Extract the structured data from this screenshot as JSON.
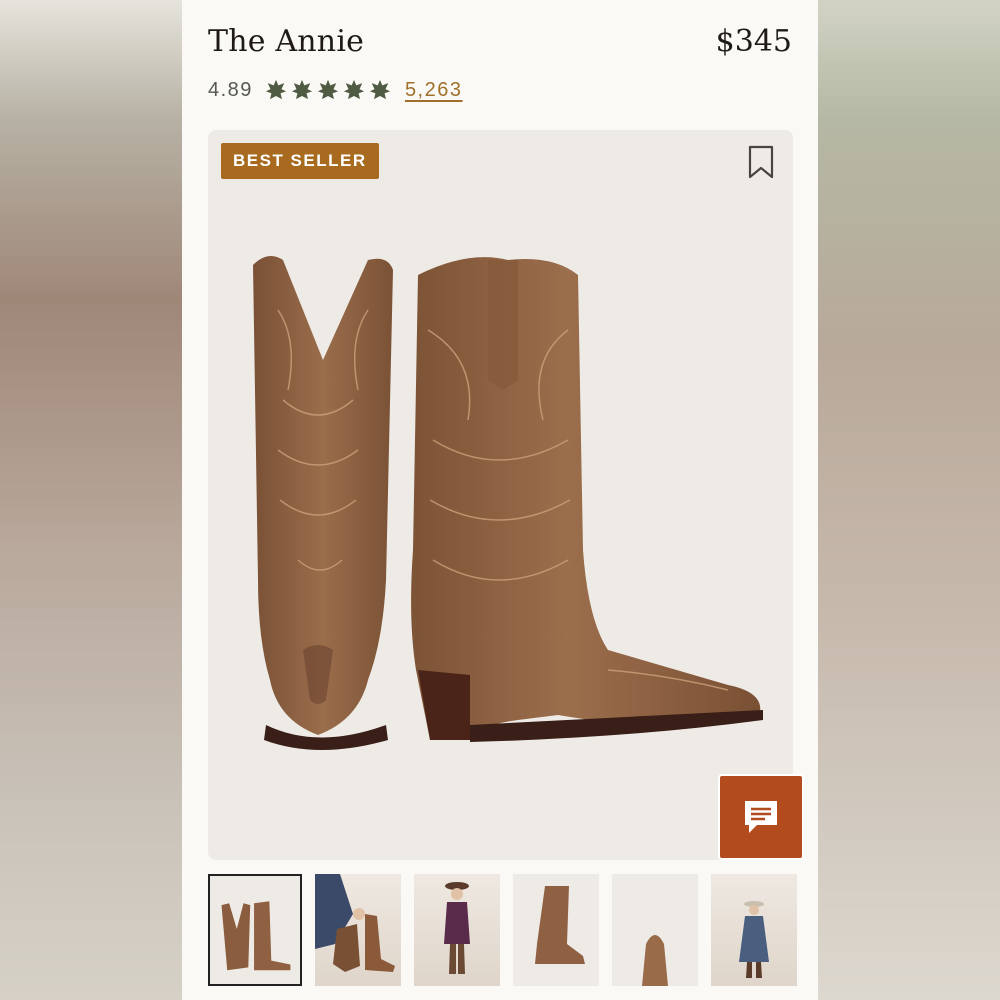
{
  "product": {
    "name": "The Annie",
    "price": "$345",
    "rating": "4.89",
    "review_count": "5,263",
    "stars": 5
  },
  "hero": {
    "badge": "BEST SELLER",
    "bookmark_icon": "bookmark-icon"
  },
  "chat": {
    "icon": "chat-icon",
    "color": "#b24b1e"
  },
  "thumbnails": [
    {
      "name": "boots-pair",
      "active": true
    },
    {
      "name": "model-pulling-on-boot",
      "active": false
    },
    {
      "name": "model-standing-hat",
      "active": false
    },
    {
      "name": "boot-side-view",
      "active": false
    },
    {
      "name": "toe-closeup",
      "active": false
    },
    {
      "name": "model-denim-dress",
      "active": false
    }
  ],
  "colors": {
    "accent": "#a76a1e",
    "star": "#4f5b43",
    "link": "#a0702a"
  }
}
